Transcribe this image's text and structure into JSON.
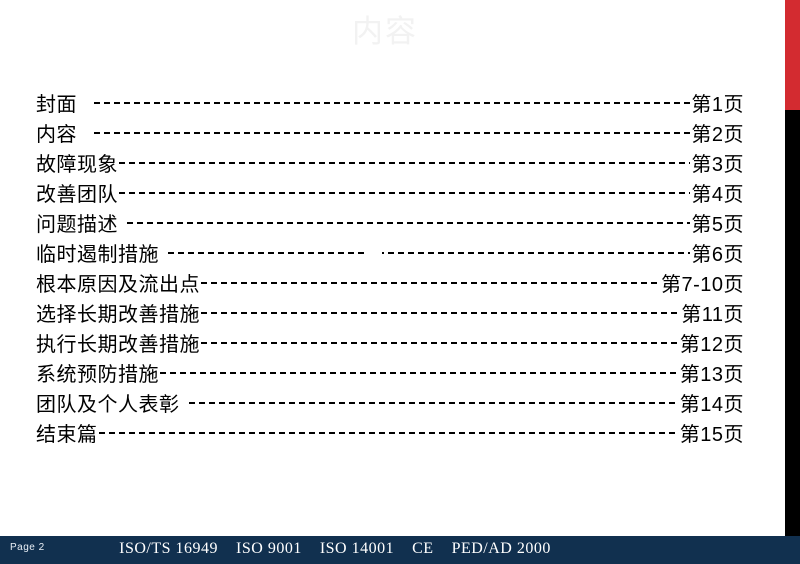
{
  "slide": {
    "title": "内容",
    "colors": {
      "accent_red": "#d32b30",
      "accent_black": "#000000",
      "footer_navy": "#11304f",
      "title_watermark": "#f2f2f2"
    }
  },
  "toc": {
    "rows": [
      {
        "label": "封面",
        "page": "第1页",
        "label_pad": "pad-wide",
        "gap": false
      },
      {
        "label": "内容",
        "page": "第2页",
        "label_pad": "pad-wide",
        "gap": false
      },
      {
        "label": "故障现象",
        "page": "第3页",
        "label_pad": "pad-none",
        "gap": false
      },
      {
        "label": "改善团队",
        "page": "第4页",
        "label_pad": "pad-none",
        "gap": false
      },
      {
        "label": "问题描述",
        "page": "第5页",
        "label_pad": "pad-med",
        "gap": false
      },
      {
        "label": "临时遏制措施",
        "page": "第6页",
        "label_pad": "pad-med",
        "gap": true
      },
      {
        "label": "根本原因及流出点",
        "page": "第7-10页",
        "label_pad": "pad-none",
        "gap": false
      },
      {
        "label": "选择长期改善措施",
        "page": "第11页",
        "label_pad": "pad-none",
        "gap": false
      },
      {
        "label": "执行长期改善措施",
        "page": "第12页",
        "label_pad": "pad-none",
        "gap": false
      },
      {
        "label": "系统预防措施",
        "page": "第13页",
        "label_pad": "pad-none",
        "gap": false
      },
      {
        "label": "团队及个人表彰",
        "page": "第14页",
        "label_pad": "pad-med",
        "gap": false
      },
      {
        "label": "结束篇",
        "page": "第15页",
        "label_pad": "pad-none",
        "gap": false
      }
    ]
  },
  "footer": {
    "page_label": "Page  2",
    "certs": [
      "ISO/TS  16949",
      "ISO 9001",
      "ISO 14001",
      "CE",
      "PED/AD  2000"
    ]
  }
}
